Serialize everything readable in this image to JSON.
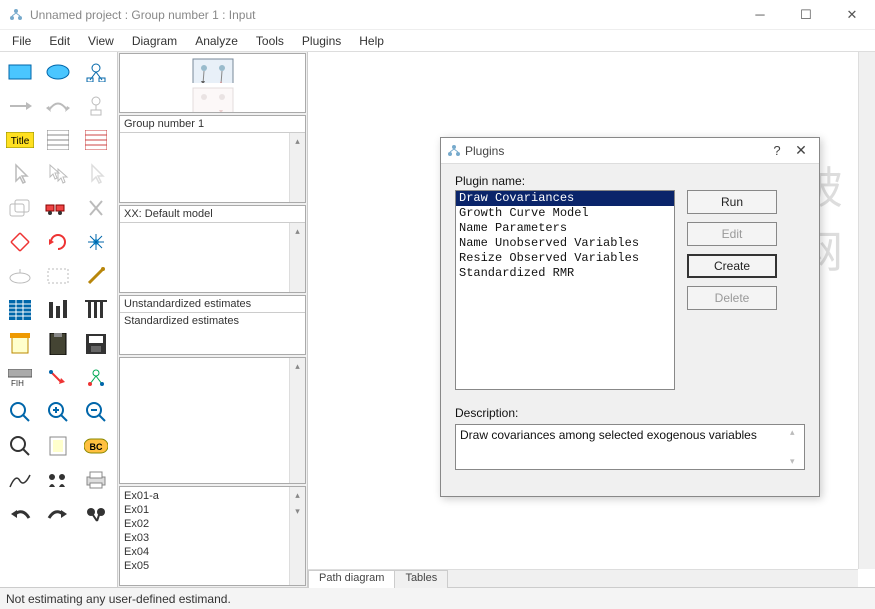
{
  "window": {
    "title": "Unnamed project : Group number 1 : Input"
  },
  "menu": [
    "File",
    "Edit",
    "View",
    "Diagram",
    "Analyze",
    "Tools",
    "Plugins",
    "Help"
  ],
  "panels": {
    "group": "Group number 1",
    "model": "XX: Default model",
    "estimates": [
      "Unstandardized estimates",
      "Standardized estimates"
    ],
    "files": [
      "Ex01-a",
      "Ex01",
      "Ex02",
      "Ex03",
      "Ex04",
      "Ex05"
    ]
  },
  "tabs": {
    "path": "Path diagram",
    "tables": "Tables"
  },
  "status": "Not estimating any user-defined estimand.",
  "dialog": {
    "title": "Plugins",
    "label_name": "Plugin name:",
    "label_desc": "Description:",
    "items": [
      "Draw Covariances",
      "Growth Curve Model",
      "Name Parameters",
      "Name Unobserved Variables",
      "Resize Observed Variables",
      "Standardized RMR"
    ],
    "selected_index": 0,
    "buttons": {
      "run": "Run",
      "edit": "Edit",
      "create": "Create",
      "delete": "Delete"
    },
    "description": "Draw covariances among selected exogenous variables"
  },
  "watermark": "亿破姐网站"
}
